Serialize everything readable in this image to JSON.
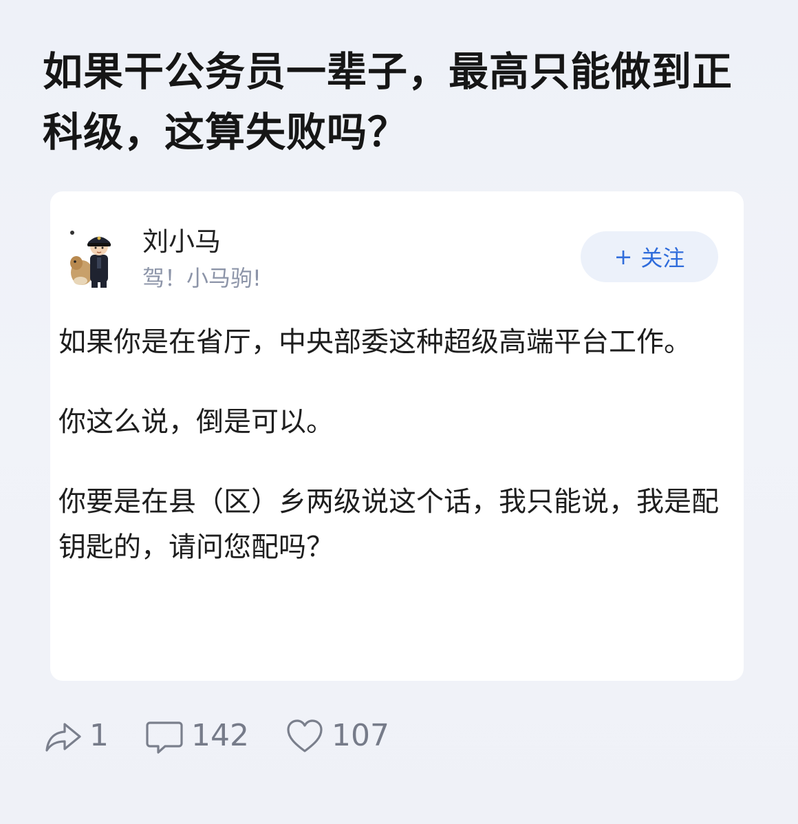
{
  "question": {
    "title": "如果干公务员一辈子，最高只能做到正科级，这算失败吗？"
  },
  "answer": {
    "author_name": "刘小马",
    "author_bio": "驾！小马驹!",
    "follow_label": "关注",
    "follow_plus": "+",
    "paragraphs": [
      "如果你是在省厅，中央部委这种超级高端平台工作。",
      "你这么说，倒是可以。",
      "你要是在县（区）乡两级说这个话，我只能说，我是配钥匙的，请问您配吗？"
    ]
  },
  "actions": {
    "share_count": "1",
    "comment_count": "142",
    "like_count": "107",
    "share_icon": "share-arrow-icon",
    "comment_icon": "comment-bubble-icon",
    "like_icon": "heart-icon",
    "icon_color": "#7a7f8c"
  },
  "colors": {
    "background": "#eef1f8",
    "card": "#ffffff",
    "follow_bg": "#ecf1fa",
    "follow_text": "#2f6cdb",
    "bio_text": "#8c94a8"
  }
}
